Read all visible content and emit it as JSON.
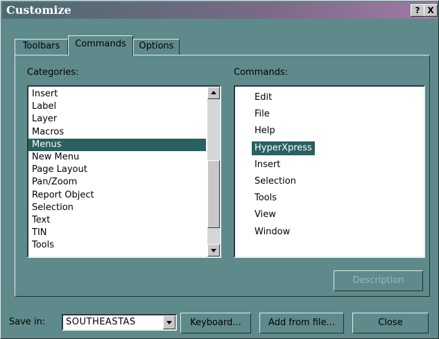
{
  "window": {
    "title": "Customize",
    "help_glyph": "?",
    "close_glyph": "X"
  },
  "tabs": [
    {
      "label": "Toolbars",
      "selected": false
    },
    {
      "label": "Commands",
      "selected": true
    },
    {
      "label": "Options",
      "selected": false
    }
  ],
  "categories": {
    "label": "Categories:",
    "items": [
      "Insert",
      "Label",
      "Layer",
      "Macros",
      "Menus",
      "New Menu",
      "Page Layout",
      "Pan/Zoom",
      "Report Object",
      "Selection",
      "Text",
      "TIN",
      "Tools"
    ],
    "selected": "Menus"
  },
  "commands": {
    "label": "Commands:",
    "items": [
      "Edit",
      "File",
      "Help",
      "HyperXpress",
      "Insert",
      "Selection",
      "Tools",
      "View",
      "Window"
    ],
    "selected": "HyperXpress"
  },
  "description_button": {
    "label": "Description",
    "enabled": false
  },
  "footer": {
    "save_in_label": "Save in:",
    "save_in_value": "SOUTHEASTAS",
    "keyboard_label": "Keyboard...",
    "add_from_file_label": "Add from file...",
    "close_label": "Close"
  },
  "colors": {
    "dialog_bg": "#5f8a8b",
    "selection_bg": "#2a6060",
    "title_gradient_start": "#4a6a6f",
    "title_gradient_end": "#a07aa6"
  }
}
